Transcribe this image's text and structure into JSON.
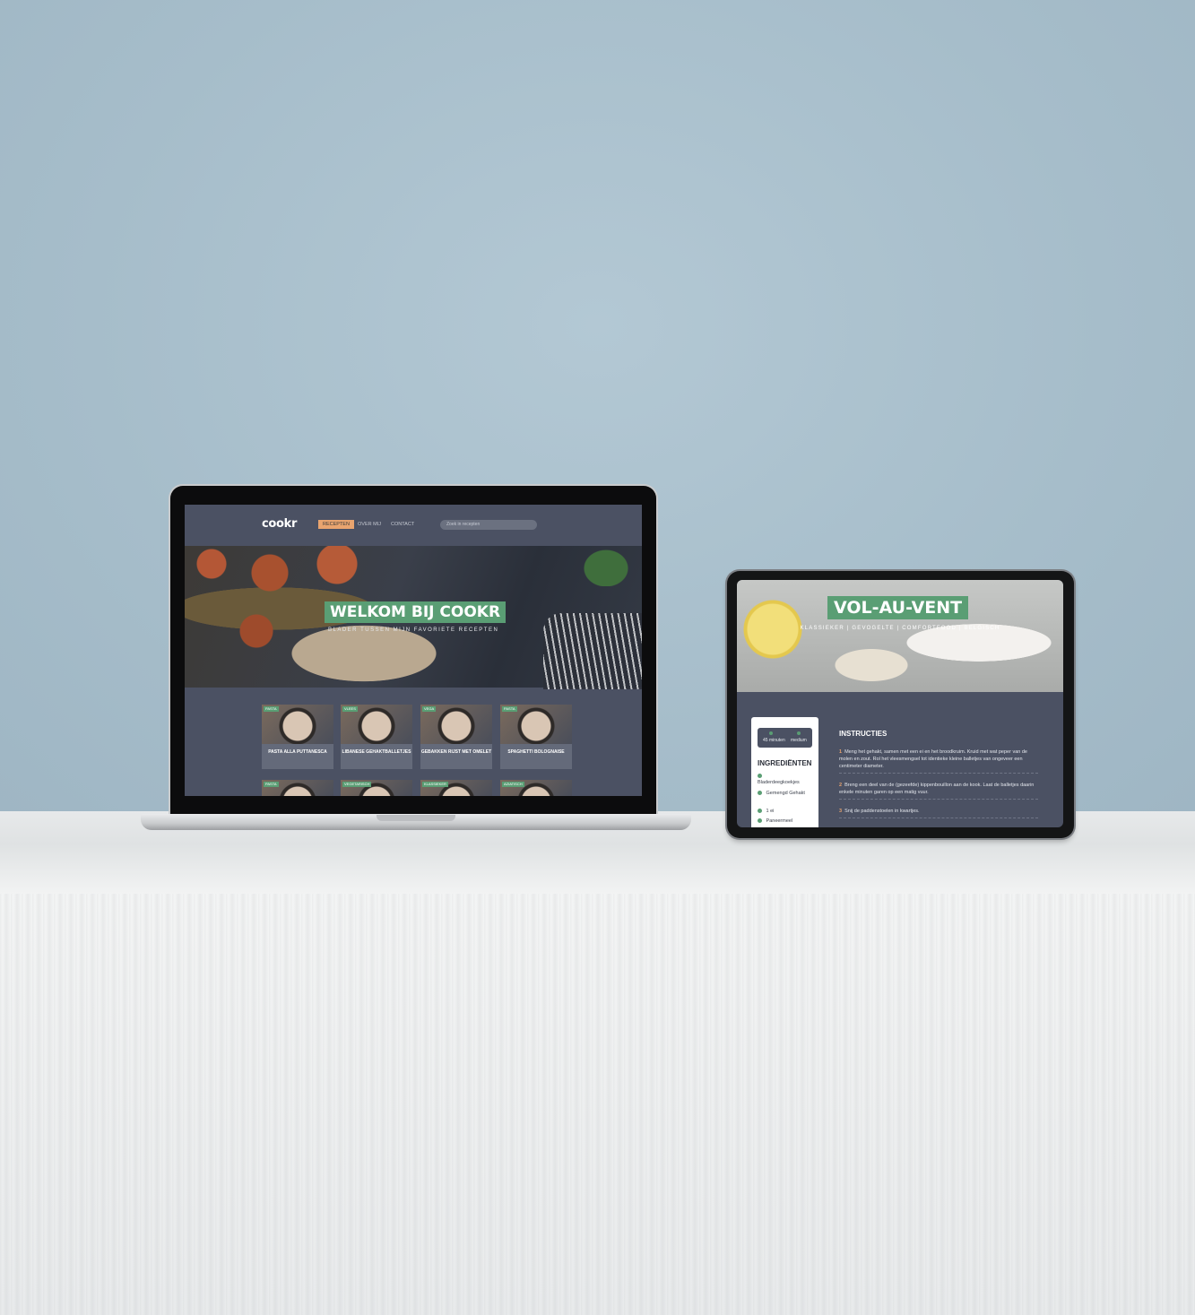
{
  "laptop": {
    "logo": "cookr",
    "nav": [
      {
        "label": "RECEPTEN",
        "active": true
      },
      {
        "label": "OVER MIJ",
        "active": false
      },
      {
        "label": "CONTACT",
        "active": false
      }
    ],
    "search_placeholder": "Zoek in recepten",
    "hero": {
      "title": "WELKOM BIJ COOKR",
      "subtitle": "BLADER TUSSEN MIJN FAVORIETE RECEPTEN"
    },
    "cards_row1": [
      {
        "tag": "PASTA",
        "title": "PASTA ALLA PUTTANESCA"
      },
      {
        "tag": "VLEES",
        "title": "LIBANESE GEHAKTBALLETJES"
      },
      {
        "tag": "VEGA",
        "title": "GEBAKKEN RIJST MET OMELET"
      },
      {
        "tag": "PASTA",
        "title": "SPAGHETTI BOLOGNAISE"
      }
    ],
    "cards_row2": [
      {
        "tag": "PASTA"
      },
      {
        "tag": "VEGETARISCH"
      },
      {
        "tag": ""
      },
      {
        "tag": "KLASSIEKER"
      },
      {
        "tag": "AZIATISCH"
      }
    ]
  },
  "tablet": {
    "hero": {
      "title": "VOL-AU-VENT",
      "subtitle": "KLASSIEKER | GEVOGELTE | COMFORTFOOD | BELGISCH"
    },
    "meta": {
      "time": "45 minuten",
      "difficulty": "medium"
    },
    "ingredients_title": "INGREDIËNTEN",
    "ingredients": [
      "Bladerdeegkoekjes",
      "Gemengd Gehakt",
      "1 ei",
      "Paneermeel"
    ],
    "instructions_title": "INSTRUCTIES",
    "steps": [
      {
        "num": "1",
        "text": "Meng het gehakt, samen met een ei en het broodkruim. Kruid met wat peper van de molen en zout. Rol het vleesmengsel tot identieke kleine balletjes van ongeveer een centimeter diameter."
      },
      {
        "num": "2",
        "text": "Breng een deel van de (gezeefde) kippenbouillon aan de kook. Laat de balletjes daarin enkele minuten garen op een matig vuur."
      },
      {
        "num": "3",
        "text": "Snij de paddenstoelen in kwartjes."
      }
    ]
  }
}
